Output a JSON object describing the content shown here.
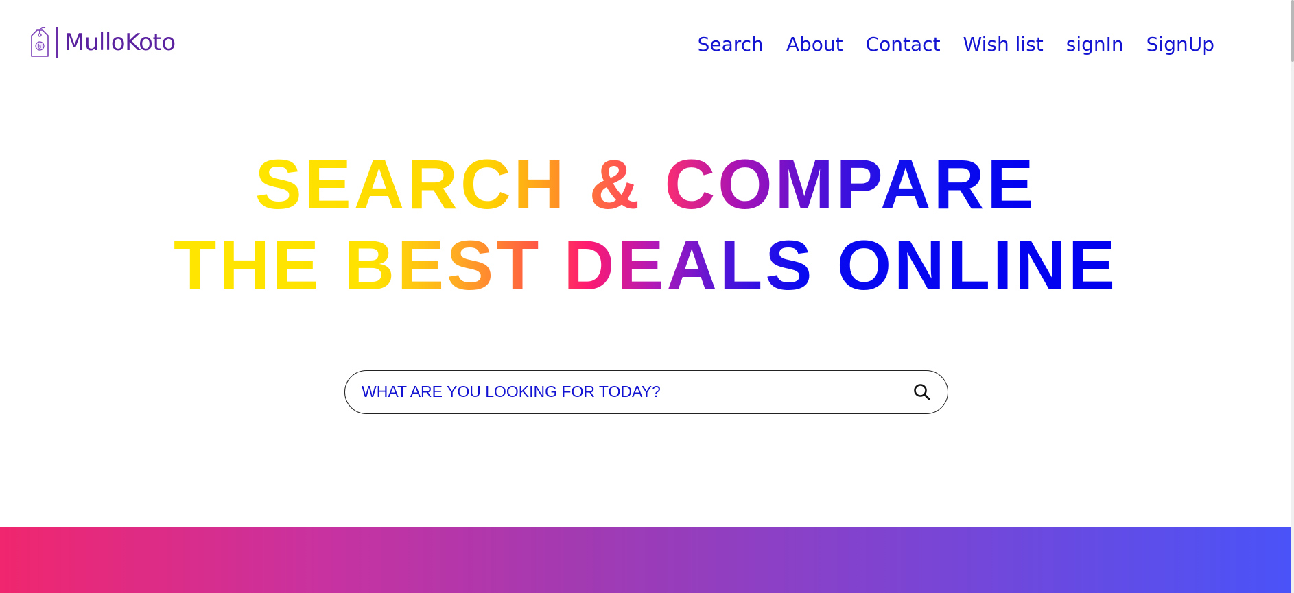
{
  "brand": {
    "name": "MulloKoto",
    "logo_icon": "price-tag-icon",
    "color": "#5b22a0"
  },
  "nav": {
    "items": [
      {
        "label": "Search"
      },
      {
        "label": "About"
      },
      {
        "label": "Contact"
      },
      {
        "label": "Wish list"
      },
      {
        "label": "signIn"
      },
      {
        "label": "SignUp"
      }
    ],
    "color": "#1313d2"
  },
  "hero": {
    "line1": "SEARCH & COMPARE",
    "line2": "THE BEST DEALS ONLINE",
    "gradient_colors": [
      "#ffe600",
      "#ff8a2a",
      "#ff2e6e",
      "#a312b8",
      "#0000f0"
    ]
  },
  "search": {
    "placeholder": "WHAT ARE YOU LOOKING FOR TODAY?",
    "value": "",
    "icon": "search-icon"
  },
  "footer_band": {
    "gradient_colors": [
      "#f0266e",
      "#a23ab2",
      "#4a53f8"
    ]
  }
}
